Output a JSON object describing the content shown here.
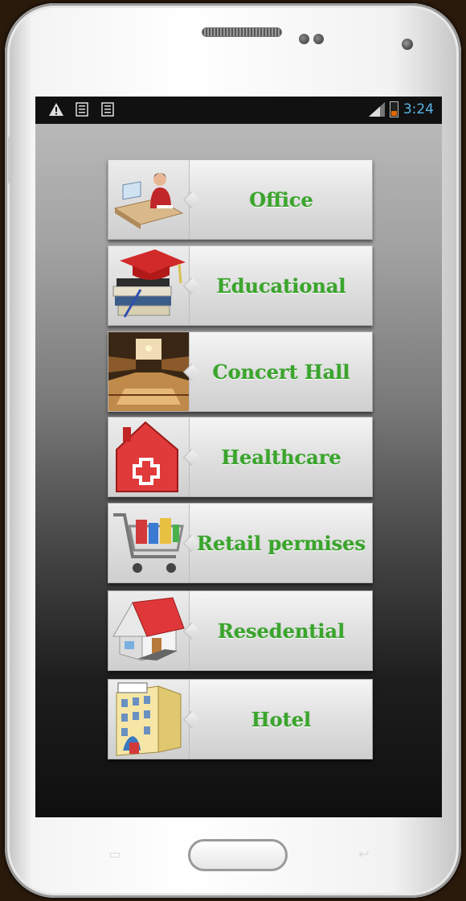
{
  "status_bar": {
    "left_icons": [
      "warning-icon",
      "notification-list-icon",
      "notification-list-icon"
    ],
    "time": "3:24",
    "battery_color": "#e06a00",
    "clock_color": "#5ab6e8"
  },
  "menu": {
    "label_color": "#3aa52c",
    "items": [
      {
        "label": "Office",
        "icon": "office-worker-icon"
      },
      {
        "label": "Educational",
        "icon": "graduation-cap-books-icon"
      },
      {
        "label": "Concert Hall",
        "icon": "concert-hall-interior-icon"
      },
      {
        "label": "Healthcare",
        "icon": "medical-house-cross-icon"
      },
      {
        "label": "Retail permises",
        "icon": "shopping-cart-icon"
      },
      {
        "label": "Resedential",
        "icon": "house-icon"
      },
      {
        "label": "Hotel",
        "icon": "hotel-building-icon"
      }
    ]
  }
}
